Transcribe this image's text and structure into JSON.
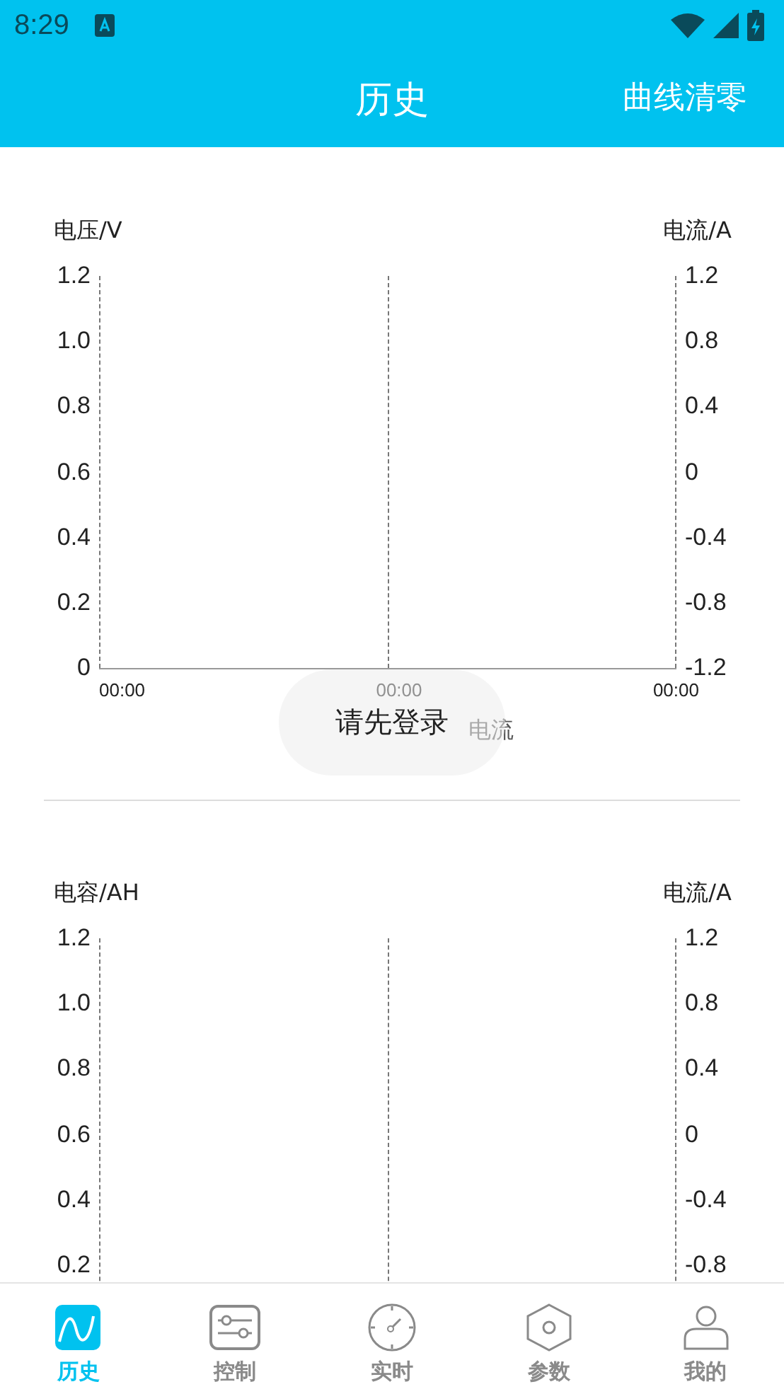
{
  "status_bar": {
    "time": "8:29"
  },
  "header": {
    "title": "历史",
    "action": "曲线清零"
  },
  "charts": [
    {
      "left_title": "电压/V",
      "right_title": "电流/A",
      "left_ticks": [
        "1.2",
        "1.0",
        "0.8",
        "0.6",
        "0.4",
        "0.2",
        "0"
      ],
      "right_ticks": [
        "1.2",
        "0.8",
        "0.4",
        "0",
        "-0.4",
        "-0.8",
        "-1.2"
      ],
      "x_labels": [
        "00:00",
        "00:00",
        "00:00"
      ],
      "legend": [
        {
          "label": "电流"
        }
      ]
    },
    {
      "left_title": "电容/AH",
      "right_title": "电流/A",
      "left_ticks": [
        "1.2",
        "1.0",
        "0.8",
        "0.6",
        "0.4",
        "0.2"
      ],
      "right_ticks": [
        "1.2",
        "0.8",
        "0.4",
        "0",
        "-0.4",
        "-0.8"
      ]
    }
  ],
  "toast": "请先登录",
  "nav": [
    {
      "kind": "curve",
      "label": "历史",
      "selected": true
    },
    {
      "kind": "sliders",
      "label": "控制",
      "selected": false
    },
    {
      "kind": "gauge",
      "label": "实时",
      "selected": false
    },
    {
      "kind": "hexagon",
      "label": "参数",
      "selected": false
    },
    {
      "kind": "person",
      "label": "我的",
      "selected": false
    }
  ]
}
